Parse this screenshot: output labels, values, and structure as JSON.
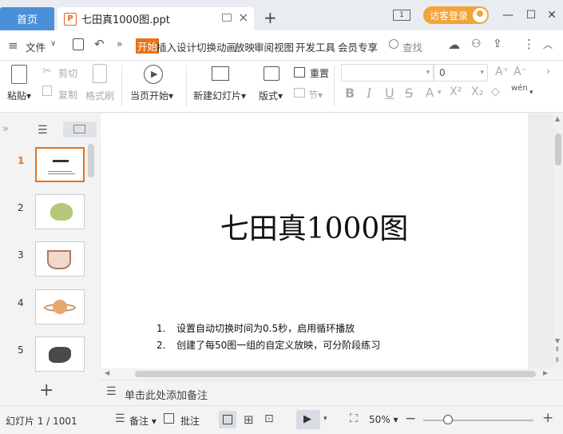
{
  "titlebar": {
    "home_tab": "首页",
    "doc_tab_icon": "P",
    "doc_title": "七田真1000图.ppt",
    "new_tab": "+",
    "window_count": "1",
    "guest_login": "访客登录"
  },
  "menubar": {
    "file": "文件",
    "tabs": [
      "开始",
      "插入",
      "设计",
      "切换",
      "动画",
      "放映",
      "审阅",
      "视图",
      "开发工具",
      "会员专享"
    ],
    "search": "查找"
  },
  "ribbon": {
    "paste": "粘贴",
    "cut": "剪切",
    "copy": "复制",
    "format_painter": "格式刷",
    "play_from_current": "当页开始",
    "new_slide": "新建幻灯片",
    "layout": "版式",
    "reset": "重置",
    "section": "节",
    "font_size": "0",
    "bold": "B",
    "italic": "I",
    "underline": "U",
    "strike": "S",
    "font_color": "A",
    "superscript": "X²",
    "subscript": "X₂",
    "pinyin": "wén"
  },
  "slides": [
    "1",
    "2",
    "3",
    "4",
    "5"
  ],
  "slide": {
    "title": "七田真1000图",
    "items": [
      {
        "num": "1.",
        "text": "设置自动切换时间为0.5秒，启用循环播放"
      },
      {
        "num": "2.",
        "text": "创建了每50图一组的自定义放映，可分阶段练习"
      }
    ]
  },
  "notes_placeholder": "单击此处添加备注",
  "statusbar": {
    "slide_counter": "幻灯片 1 / 1001",
    "notes": "备注",
    "comments": "批注",
    "zoom": "50%"
  },
  "colors": {
    "accent": "#e8721b",
    "home_tab": "#4a90d9",
    "guest": "#f2a43a"
  }
}
